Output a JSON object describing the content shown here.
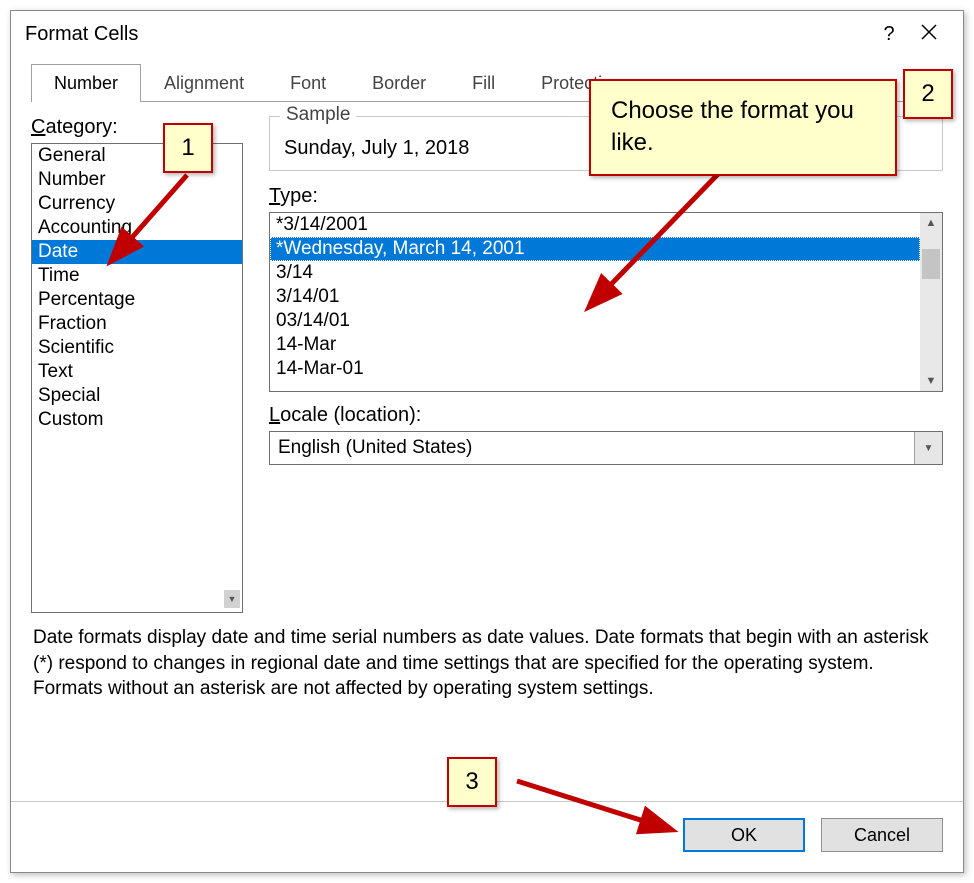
{
  "title": "Format Cells",
  "tabs": [
    "Number",
    "Alignment",
    "Font",
    "Border",
    "Fill",
    "Protection"
  ],
  "active_tab": 0,
  "category_label": "Category:",
  "categories": [
    "General",
    "Number",
    "Currency",
    "Accounting",
    "Date",
    "Time",
    "Percentage",
    "Fraction",
    "Scientific",
    "Text",
    "Special",
    "Custom"
  ],
  "selected_category": 4,
  "sample_label": "Sample",
  "sample_value": "Sunday, July 1, 2018",
  "type_label": "Type:",
  "types": [
    "*3/14/2001",
    "*Wednesday, March 14, 2001",
    "3/14",
    "3/14/01",
    "03/14/01",
    "14-Mar",
    "14-Mar-01"
  ],
  "selected_type": 1,
  "locale_label": "Locale (location):",
  "locale_value": "English (United States)",
  "description": "Date formats display date and time serial numbers as date values.  Date formats that begin with an asterisk (*) respond to changes in regional date and time settings that are specified for the operating system. Formats without an asterisk are not affected by operating system settings.",
  "ok_label": "OK",
  "cancel_label": "Cancel",
  "annotations": {
    "step1": "1",
    "step2": "2",
    "step3": "3",
    "tip": "Choose the format you like."
  }
}
